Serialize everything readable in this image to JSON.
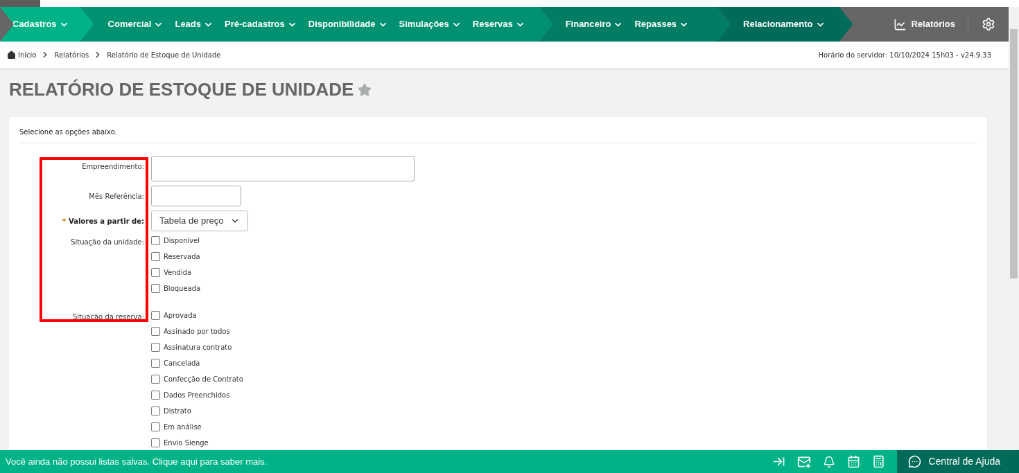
{
  "nav": {
    "segments": [
      {
        "color": "#00b386",
        "items": [
          {
            "label": "Cadastros"
          }
        ]
      },
      {
        "color": "#009270",
        "items": [
          {
            "label": "Comercial"
          },
          {
            "label": "Leads"
          },
          {
            "label": "Pré-cadastros"
          },
          {
            "label": "Disponibilidade"
          },
          {
            "label": "Simulações"
          },
          {
            "label": "Reservas"
          }
        ]
      },
      {
        "color": "#007d62",
        "items": [
          {
            "label": "Financeiro"
          },
          {
            "label": "Repasses"
          }
        ]
      },
      {
        "color": "#006b58",
        "items": [
          {
            "label": "Relacionamento"
          }
        ]
      }
    ],
    "reports": "Relatórios"
  },
  "breadcrumb": [
    "Início",
    "Relatórios",
    "Relatório de Estoque de Unidade"
  ],
  "server_time": "Horário do servidor: 10/10/2024 15h03 - v24.9.33",
  "page_title": "RELATÓRIO DE ESTOQUE DE UNIDADE",
  "favorite": false,
  "intro": "Selecione as opções abaixo.",
  "fields": [
    {
      "kind": "text",
      "label": "Empreendimento:"
    },
    {
      "kind": "text",
      "label": "Mês Referência:"
    },
    {
      "kind": "select",
      "required_mark": "*",
      "label": "Valores a partir de:",
      "value": "Tabela de preço"
    },
    {
      "kind": "checks",
      "label": "Situação da unidade:",
      "options": [
        {
          "label": "Disponível",
          "checked": false
        },
        {
          "label": "Reservada",
          "checked": false
        },
        {
          "label": "Vendida",
          "checked": false
        },
        {
          "label": "Bloqueada",
          "checked": false
        }
      ]
    },
    {
      "kind": "checks",
      "label": "Situação da reserva:",
      "options": [
        {
          "label": "Aprovada",
          "checked": false
        },
        {
          "label": "Assinado por todos",
          "checked": false
        },
        {
          "label": "Assinatura contrato",
          "checked": false
        },
        {
          "label": "Cancelada",
          "checked": false
        },
        {
          "label": "Confecção de Contrato",
          "checked": false
        },
        {
          "label": "Dados Preenchidos",
          "checked": false
        },
        {
          "label": "Distrato",
          "checked": false
        },
        {
          "label": "Em análise",
          "checked": false
        },
        {
          "label": "Envio Sienge",
          "checked": false
        }
      ]
    }
  ],
  "bottom_bar": {
    "message": "Você ainda não possui listas salvas. Clique aqui para saber mais.",
    "help": "Central de Ajuda"
  }
}
